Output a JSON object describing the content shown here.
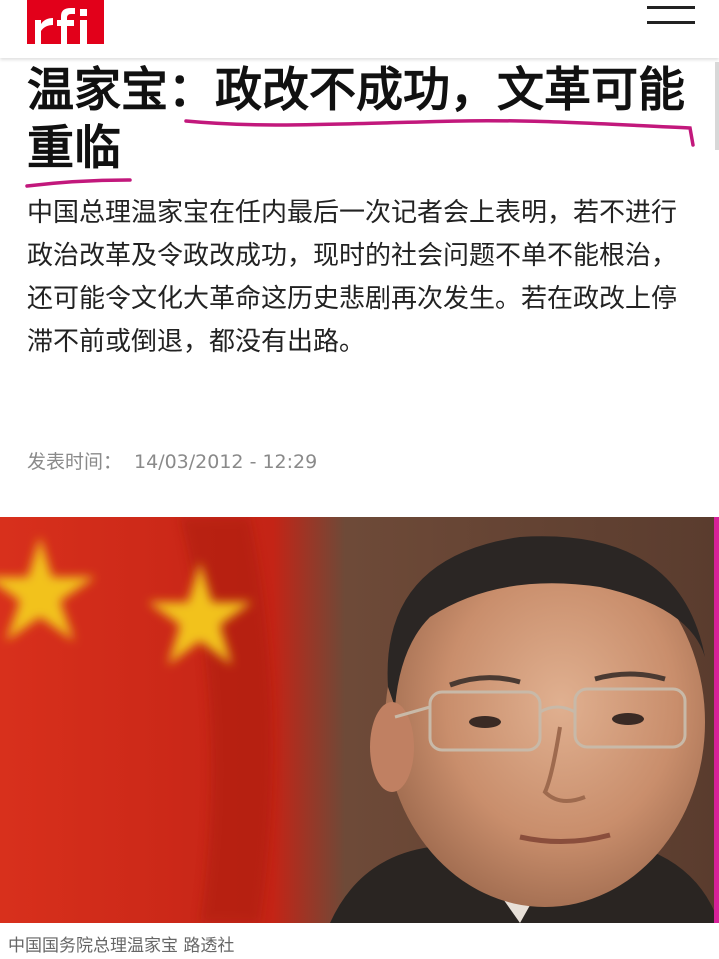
{
  "header": {
    "logo_text": "rfi",
    "menu_icon": "hamburger-menu-icon"
  },
  "article": {
    "title": "温家宝：政改不成功，文革可能重临",
    "summary": "中国总理温家宝在任内最后一次记者会上表明，若不进行政治改革及令政改成功，现时的社会问题不单不能根治，还可能令文化大革命这历史悲剧再次发生。若在政改上停滞不前或倒退，都没有出路。",
    "published_label": "发表时间：",
    "published_time": "14/03/2012 - 12:29",
    "image_caption": "中国国务院总理温家宝  路透社"
  },
  "colors": {
    "brand_red": "#e2001a",
    "annotation_magenta": "#c2187c",
    "meta_gray": "#8a8a8a"
  }
}
